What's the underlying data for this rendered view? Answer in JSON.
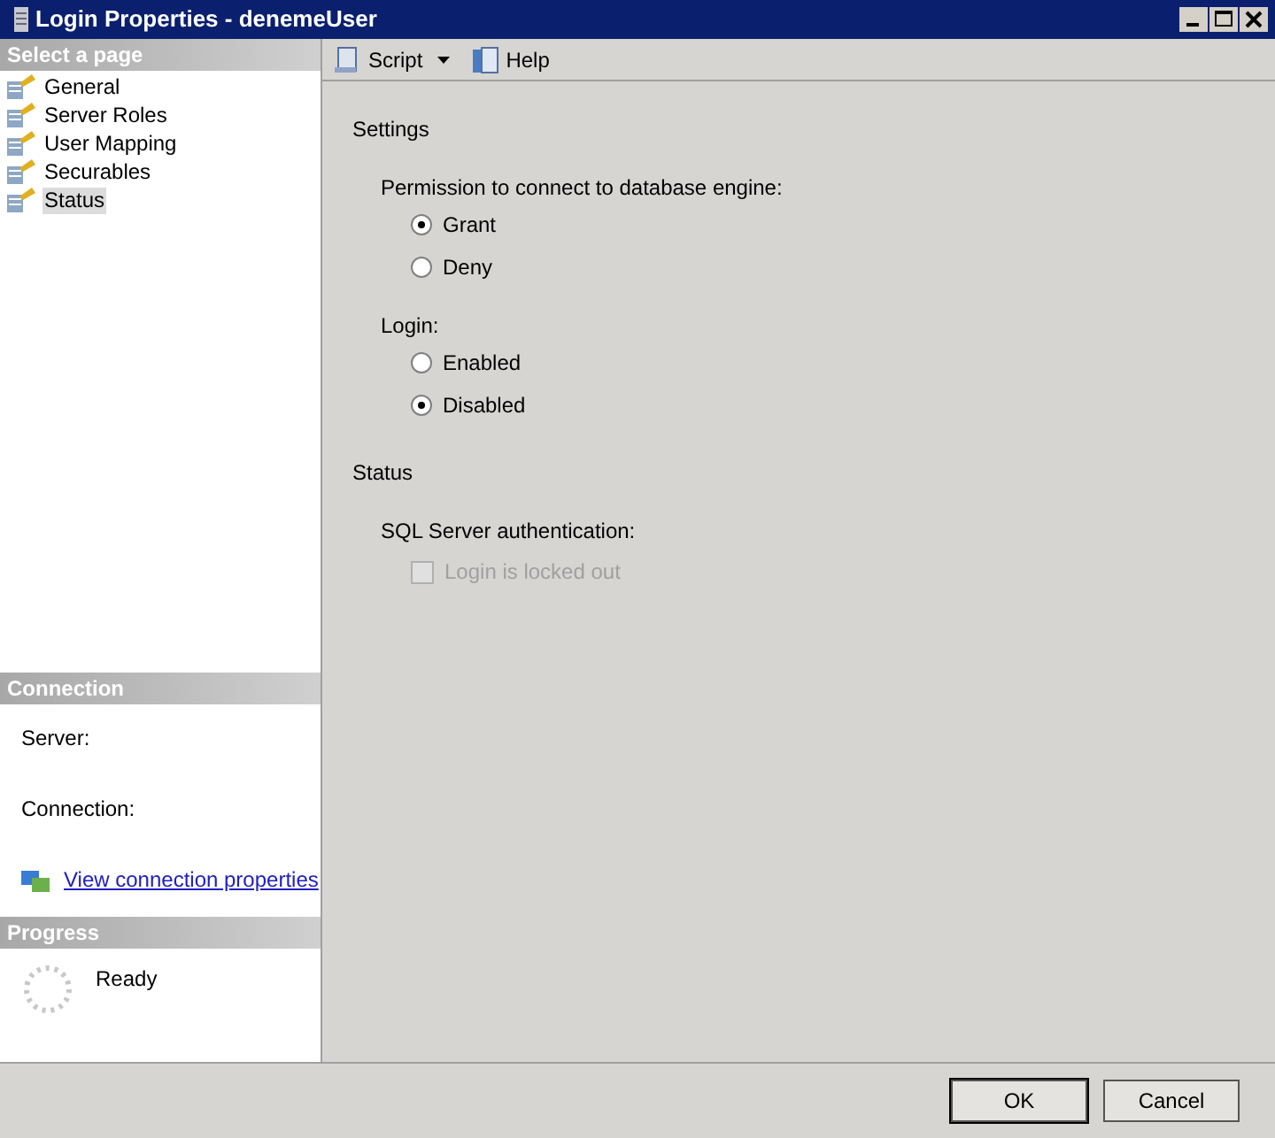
{
  "window": {
    "title": "Login Properties - denemeUser"
  },
  "sidebar": {
    "header": "Select a page",
    "items": [
      {
        "label": "General",
        "selected": false
      },
      {
        "label": "Server Roles",
        "selected": false
      },
      {
        "label": "User Mapping",
        "selected": false
      },
      {
        "label": "Securables",
        "selected": false
      },
      {
        "label": "Status",
        "selected": true
      }
    ]
  },
  "connection": {
    "header": "Connection",
    "server_label": "Server:",
    "connection_label": "Connection:",
    "link": "View connection properties"
  },
  "progress": {
    "header": "Progress",
    "status": "Ready"
  },
  "toolbar": [
    {
      "label": "Script",
      "kind": "script"
    },
    {
      "label": "Help",
      "kind": "help"
    }
  ],
  "sections": [
    {
      "heading": "Settings",
      "groups": [
        {
          "label": "Permission to connect to database engine:",
          "kind": "radio",
          "options": [
            {
              "label": "Grant",
              "selected": true
            },
            {
              "label": "Deny",
              "selected": false
            }
          ]
        },
        {
          "label": "Login:",
          "kind": "radio",
          "options": [
            {
              "label": "Enabled",
              "selected": false
            },
            {
              "label": "Disabled",
              "selected": true
            }
          ]
        }
      ]
    },
    {
      "heading": "Status",
      "groups": [
        {
          "label": "SQL Server authentication:",
          "kind": "checkbox",
          "options": [
            {
              "label": "Login is locked out",
              "checked": false,
              "disabled": true
            }
          ]
        }
      ]
    }
  ],
  "buttons": [
    "OK",
    "Cancel"
  ]
}
